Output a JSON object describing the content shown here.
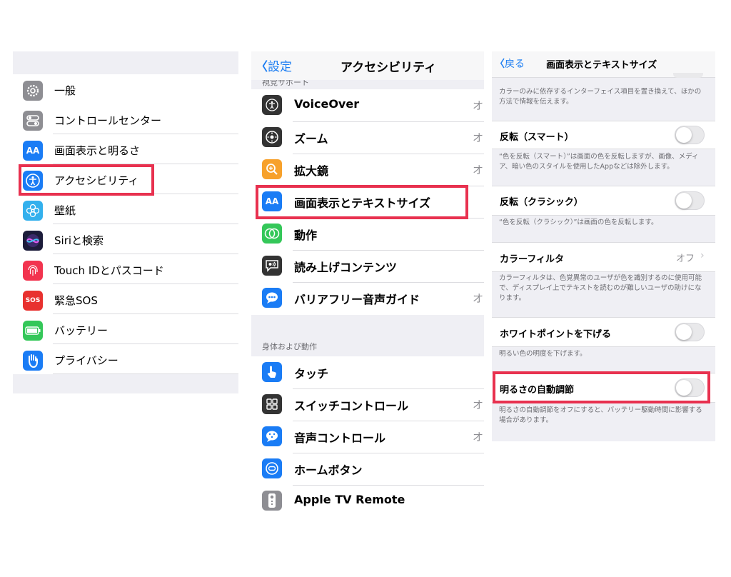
{
  "panel1": {
    "items": [
      {
        "label": "一般",
        "icon": "gear-icon"
      },
      {
        "label": "コントロールセンター",
        "icon": "toggles-icon"
      },
      {
        "label": "画面表示と明るさ",
        "icon": "text-size-icon"
      },
      {
        "label": "アクセシビリティ",
        "icon": "accessibility-icon"
      },
      {
        "label": "壁紙",
        "icon": "flower-icon"
      },
      {
        "label": "Siriと検索",
        "icon": "siri-icon"
      },
      {
        "label": "Touch IDとパスコード",
        "icon": "fingerprint-icon"
      },
      {
        "label": "緊急SOS",
        "icon": "sos-icon"
      },
      {
        "label": "バッテリー",
        "icon": "battery-icon"
      },
      {
        "label": "プライバシー",
        "icon": "hand-icon"
      }
    ]
  },
  "panel2": {
    "back_label": "設定",
    "title": "アクセシビリティ",
    "section_partial": "視覚サポート",
    "section2": "身体および動作",
    "items": [
      {
        "label": "VoiceOver",
        "value": "オ"
      },
      {
        "label": "ズーム",
        "value": "オ"
      },
      {
        "label": "拡大鏡",
        "value": "オ"
      },
      {
        "label": "画面表示とテキストサイズ",
        "value": ""
      },
      {
        "label": "動作",
        "value": ""
      },
      {
        "label": "読み上げコンテンツ",
        "value": ""
      },
      {
        "label": "バリアフリー音声ガイド",
        "value": "オ"
      }
    ],
    "items2": [
      {
        "label": "タッチ",
        "value": ""
      },
      {
        "label": "スイッチコントロール",
        "value": "オ"
      },
      {
        "label": "音声コントロール",
        "value": "オ"
      },
      {
        "label": "ホームボタン",
        "value": ""
      },
      {
        "label": "Apple TV Remote",
        "value": ""
      }
    ],
    "icon_texts": {
      "text_size": "AA",
      "speech": "(•))",
      "sos": "SOS"
    }
  },
  "panel3": {
    "back_label": "戻る",
    "title": "画面表示とテキストサイズ",
    "note0": "カラーのみに依存するインターフェイス項目を置き換えて、ほかの方法で情報を伝えます。",
    "smart_invert": "反転（スマート）",
    "smart_note": "“色を反転（スマート）”は画面の色を反転しますが、画像、メディア、暗い色のスタイルを使用したAppなどは除外します。",
    "classic_invert": "反転（クラシック）",
    "classic_note": "“色を反転（クラシック）”は画面の色を反転します。",
    "color_filter": "カラーフィルタ",
    "color_filter_value": "オフ",
    "color_filter_note": "カラーフィルタは、色覚異常のユーザが色を識別するのに使用可能で、ディスプレイ上でテキストを読むのが難しいユーザの助けになります。",
    "white_point": "ホワイトポイントを下げる",
    "white_point_note": "明るい色の明度を下げます。",
    "auto_brightness": "明るさの自動調節",
    "auto_brightness_note": "明るさの自動調節をオフにすると、バッテリー駆動時間に影響する場合があります。"
  },
  "colors": {
    "highlight": "#e8314f",
    "ios_blue": "#1d7ef2",
    "group_bg": "#efeff4"
  }
}
